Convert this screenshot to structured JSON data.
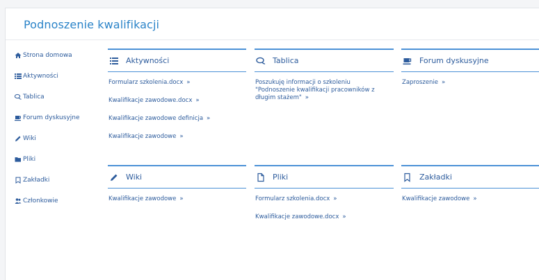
{
  "page": {
    "title": "Podnoszenie kwalifikacji"
  },
  "sidebar": {
    "items": [
      {
        "label": "Strona domowa",
        "icon": "home-icon"
      },
      {
        "label": "Aktywności",
        "icon": "list-icon"
      },
      {
        "label": "Tablica",
        "icon": "comments-icon"
      },
      {
        "label": "Forum dyskusyjne",
        "icon": "coffee-cup-icon"
      },
      {
        "label": "Wiki",
        "icon": "pencil-icon"
      },
      {
        "label": "Pliki",
        "icon": "folder-icon"
      },
      {
        "label": "Zakładki",
        "icon": "bookmark-icon"
      },
      {
        "label": "Członkowie",
        "icon": "users-icon"
      }
    ]
  },
  "widgets": {
    "aktywnosci": {
      "title": "Aktywności",
      "icon": "list-icon",
      "links": [
        "Formularz szkolenia.docx",
        "Kwalifikacje zawodowe.docx",
        "Kwalifikacje zawodowe definicja",
        "Kwalifikacje zawodowe"
      ]
    },
    "tablica": {
      "title": "Tablica",
      "icon": "comments-icon",
      "links": [
        "Poszukuję informacji o szkoleniu \"Podnoszenie kwalifikacji pracowników z długim stażem\""
      ]
    },
    "forum": {
      "title": "Forum dyskusyjne",
      "icon": "coffee-cup-icon",
      "links": [
        "Zaproszenie"
      ]
    },
    "wiki": {
      "title": "Wiki",
      "icon": "pencil-icon",
      "links": [
        "Kwalifikacje zawodowe"
      ]
    },
    "pliki": {
      "title": "Pliki",
      "icon": "file-icon",
      "links": [
        "Formularz szkolenia.docx",
        "Kwalifikacje zawodowe.docx"
      ]
    },
    "zakladki": {
      "title": "Zakładki",
      "icon": "bookmark-icon",
      "links": [
        "Kwalifikacje zawodowe"
      ]
    }
  },
  "arrow": "»",
  "colors": {
    "accent": "#4a90d6",
    "link": "#2c5b9c",
    "title": "#2a83c8"
  }
}
